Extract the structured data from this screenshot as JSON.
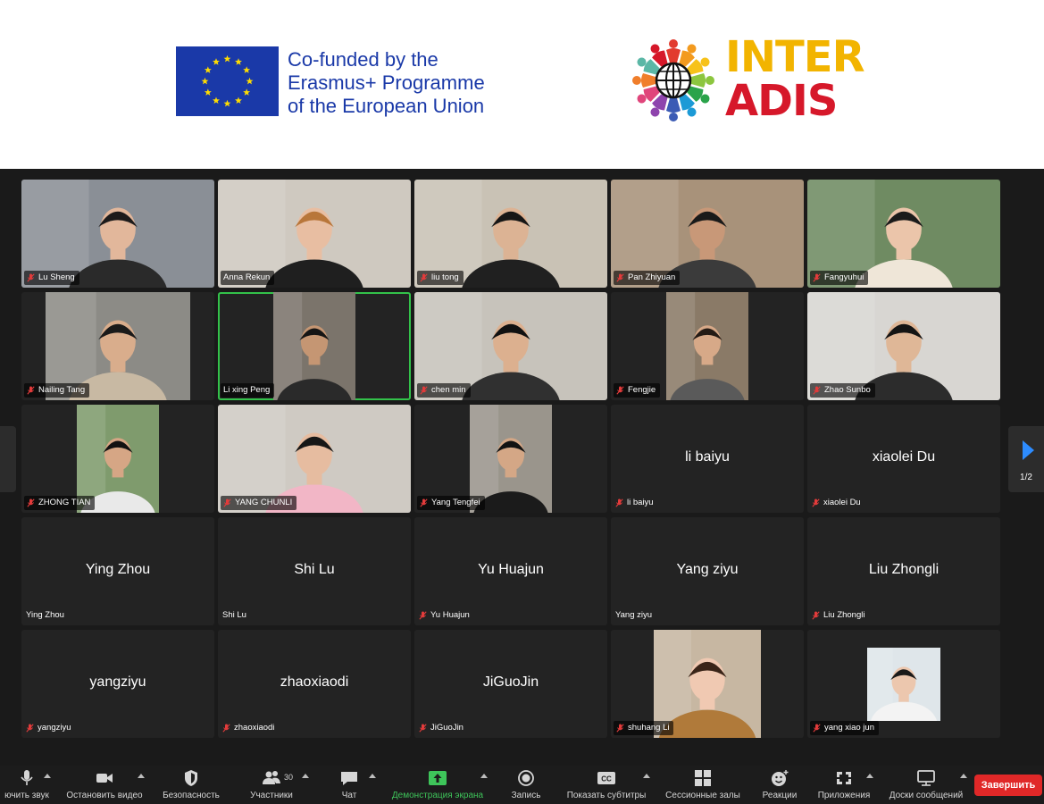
{
  "header": {
    "eu_lines": [
      "Co-funded by the",
      "Erasmus+ Programme",
      "of the European Union"
    ],
    "logo_word_1": "INTER",
    "logo_word_2": "ADIS",
    "colors": {
      "eu_blue": "#1a39a8",
      "eu_star": "#ffdd00",
      "inter": "#f2b400",
      "adis": "#d6182a"
    }
  },
  "meeting": {
    "page_indicator": "1/2",
    "active_speaker_color": "#33c24a",
    "participants": [
      {
        "name": "Lu Sheng",
        "muted": true,
        "video": true,
        "bg": "#8a8f96",
        "skin": "#e2b79b",
        "hair": "#1d1b1b",
        "shirt": "#2a2a2a"
      },
      {
        "name": "Anna Rekun",
        "muted": false,
        "video": true,
        "bg": "#cfc9c0",
        "skin": "#e8bea2",
        "hair": "#b8763a",
        "shirt": "#1f1f1f"
      },
      {
        "name": "liu tong",
        "muted": true,
        "video": true,
        "bg": "#c9c2b5",
        "skin": "#dcb394",
        "hair": "#161616",
        "shirt": "#202020"
      },
      {
        "name": "Pan Zhiyuan",
        "muted": true,
        "video": true,
        "bg": "#a8927a",
        "skin": "#c89878",
        "hair": "#1a1a1a",
        "shirt": "#3b3b3b"
      },
      {
        "name": "Fangyuhui",
        "muted": true,
        "video": true,
        "bg": "#6f8b62",
        "skin": "#ebc5aa",
        "hair": "#1b1b1b",
        "shirt": "#efe6d8"
      },
      {
        "name": "Nailing Tang",
        "muted": true,
        "video": true,
        "bg": "#8c8b86",
        "skin": "#d9ad8c",
        "hair": "#1a1a1a",
        "shirt": "#c8b9a3"
      },
      {
        "name": "Li xing Peng",
        "muted": false,
        "video": true,
        "bg": "#7b746b",
        "skin": "#c59673",
        "hair": "#151515",
        "shirt": "#2a2a2a"
      },
      {
        "name": "chen min",
        "muted": true,
        "video": true,
        "bg": "#c7c3bb",
        "skin": "#dcb08f",
        "hair": "#111111",
        "shirt": "#303030"
      },
      {
        "name": "Fengjie",
        "muted": true,
        "video": true,
        "bg": "#8a7a67",
        "skin": "#d7a988",
        "hair": "#241b15",
        "shirt": "#5a5a5a"
      },
      {
        "name": "Zhao Sunbo",
        "muted": true,
        "video": true,
        "bg": "#d8d6d2",
        "skin": "#dfb797",
        "hair": "#141414",
        "shirt": "#2c2c2c"
      },
      {
        "name": "ZHONG TIAN",
        "muted": true,
        "video": true,
        "bg": "#7f9b6d",
        "skin": "#d6a685",
        "hair": "#121212",
        "shirt": "#e9e9e9"
      },
      {
        "name": "YANG CHUNLI",
        "muted": true,
        "video": true,
        "bg": "#cfcac3",
        "skin": "#e6bca0",
        "hair": "#171717",
        "shirt": "#f2b6c6"
      },
      {
        "name": "Yang Tengfei",
        "muted": true,
        "video": true,
        "bg": "#9a958c",
        "skin": "#d4a786",
        "hair": "#121212",
        "shirt": "#1b1b1b"
      },
      {
        "name": "li baiyu",
        "muted": true,
        "video": false
      },
      {
        "name": "xiaolei Du",
        "muted": true,
        "video": false
      },
      {
        "name": "Ying Zhou",
        "muted": false,
        "video": false
      },
      {
        "name": "Shi  Lu",
        "muted": false,
        "video": false
      },
      {
        "name": "Yu Huajun",
        "muted": true,
        "video": false
      },
      {
        "name": "Yang ziyu",
        "muted": false,
        "video": false
      },
      {
        "name": "Liu Zhongli",
        "muted": true,
        "video": false
      },
      {
        "name": "yangziyu",
        "muted": true,
        "video": false
      },
      {
        "name": "zhaoxiaodi",
        "muted": true,
        "video": false
      },
      {
        "name": "JiGuoJin",
        "muted": true,
        "video": false
      },
      {
        "name": "shuhang Li",
        "muted": true,
        "video": true,
        "bg": "#c7b7a2",
        "skin": "#f0c9b2",
        "hair": "#3a2418",
        "shirt": "#b07a3a"
      },
      {
        "name": "yang xiao jun",
        "muted": true,
        "video": true,
        "bg": "#dfe6ea",
        "skin": "#ecc7ae",
        "hair": "#1a1a1a",
        "shirt": "#f3f3f3"
      }
    ]
  },
  "toolbar": {
    "unmute": "ючить звук",
    "stop_video": "Остановить видео",
    "security": "Безопасность",
    "participants": "Участники",
    "participants_count": "30",
    "chat": "Чат",
    "share_screen": "Демонстрация экрана",
    "record": "Запись",
    "captions": "Показать субтитры",
    "breakout": "Сессионные залы",
    "reactions": "Реакции",
    "apps": "Приложения",
    "whiteboards": "Доски сообщений",
    "end": "Завершить",
    "share_color": "#3ec55a",
    "end_color": "#e02828"
  }
}
